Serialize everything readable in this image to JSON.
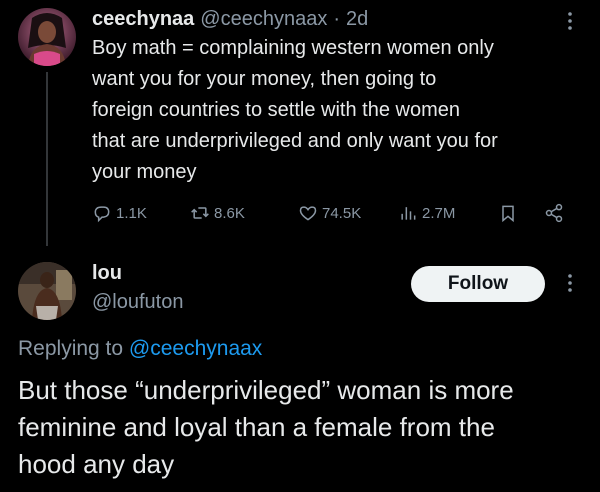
{
  "original": {
    "author_name": "ceechynaa",
    "author_handle": "@ceechynaax",
    "separator": "·",
    "time": "2d",
    "text_lines": [
      "Boy math = complaining western women only",
      "want you for your money, then going to",
      "foreign countries to settle with the women",
      "that are underprivileged and only want you for",
      "your money"
    ],
    "stats": {
      "replies": "1.1K",
      "reposts": "8.6K",
      "likes": "74.5K",
      "views": "2.7M"
    }
  },
  "reply": {
    "author_name": "lou",
    "author_handle": "@loufuton",
    "follow_label": "Follow",
    "replying_prefix": "Replying to",
    "replying_handle": "@ceechynaax",
    "text_lines": [
      "But those “underprivileged” woman is more",
      "feminine and loyal than a female from the",
      "hood any day"
    ]
  },
  "icons": {
    "reply": "reply-icon",
    "repost": "repost-icon",
    "like": "heart-icon",
    "views": "views-icon",
    "bookmark": "bookmark-icon",
    "share": "share-icon",
    "more": "more-icon"
  },
  "colors": {
    "background": "#000000",
    "text": "#e7e9ea",
    "secondary": "#8b98a5",
    "link": "#1d9bf0",
    "follow_bg": "#eff3f4"
  }
}
